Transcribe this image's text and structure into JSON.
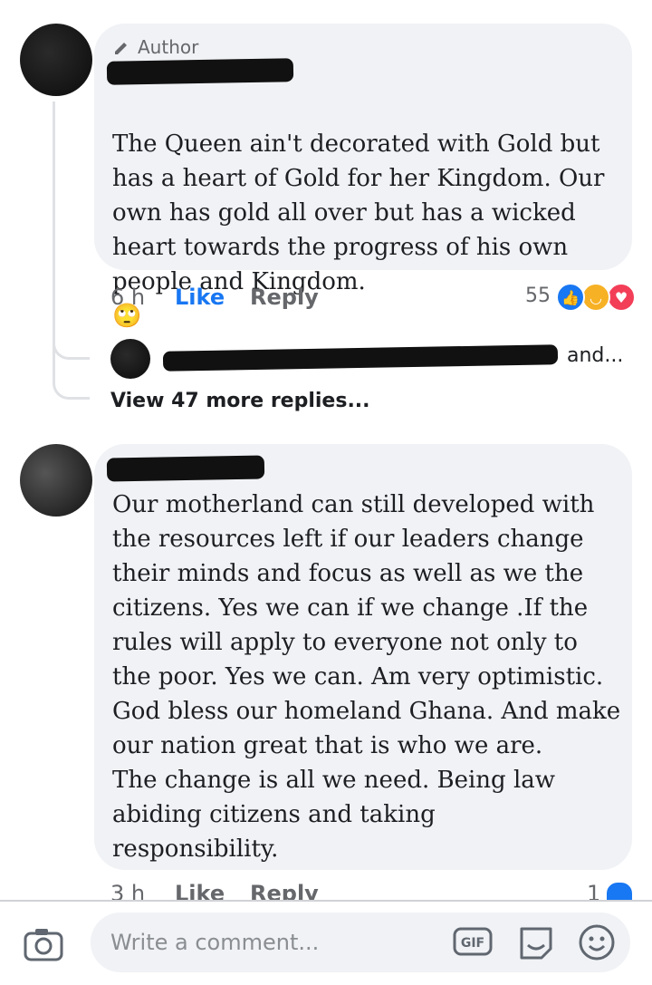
{
  "comments": [
    {
      "author_badge": "Author",
      "text": "The Queen ain't decorated with Gold but\nhas a heart of Gold for her Kingdom. Our\nown has gold all over but has a wicked\nheart towards the progress of his own\npeople and Kingdom.",
      "emoji": "🙄",
      "time": "6 h",
      "like_label": "Like",
      "reply_label": "Reply",
      "reaction_count": "55",
      "reactions": [
        "like-icon",
        "haha-icon",
        "love-icon"
      ]
    },
    {
      "text": "Our motherland can still developed with\nthe resources left if our leaders change\ntheir minds and focus as well as we the\ncitizens. Yes we can if we change .If the\nrules will apply to everyone not only to\nthe poor. Yes we can. Am very optimistic.\nGod bless our homeland Ghana. And make\nour nation great that is who  we are.\nThe change is all we need. Being law\nabiding citizens and taking\nresponsibility.",
      "time": "3 h",
      "like_label": "Like",
      "reply_label": "Reply",
      "reaction_count": "1",
      "reactions": [
        "like-icon"
      ]
    }
  ],
  "reply_preview": {
    "tail_text": "and..."
  },
  "view_more": "View 47 more replies...",
  "composer": {
    "placeholder": "Write a comment..."
  },
  "icons": {
    "camera": "camera-icon",
    "gif": "gif-icon",
    "sticker": "sticker-icon",
    "emoji": "emoji-icon"
  },
  "colors": {
    "like_blue": "#1877f2",
    "bubble": "#f0f2f5",
    "muted": "#65676b"
  }
}
